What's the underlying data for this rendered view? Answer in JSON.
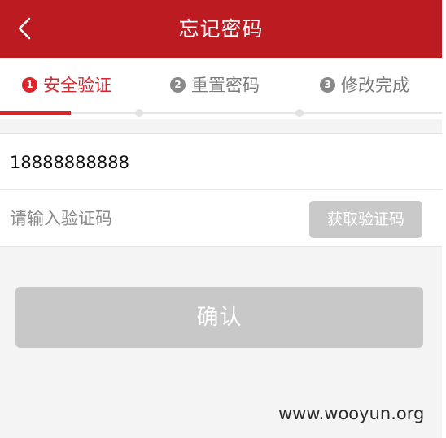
{
  "header": {
    "title": "忘记密码",
    "back_icon": "chevron-left-icon",
    "background_color": "#bd1b22"
  },
  "steps": [
    {
      "number": "1",
      "label": "安全验证",
      "active": true
    },
    {
      "number": "2",
      "label": "重置密码",
      "active": false
    },
    {
      "number": "3",
      "label": "修改完成",
      "active": false
    }
  ],
  "progress": {
    "current_step": 1,
    "total_steps": 3
  },
  "accent_color": "#d9262c",
  "form": {
    "phone_value": "18888888888",
    "code_placeholder": "请输入验证码",
    "get_code_label": "获取验证码"
  },
  "confirm_label": "确认",
  "watermark": "www.wooyun.org"
}
